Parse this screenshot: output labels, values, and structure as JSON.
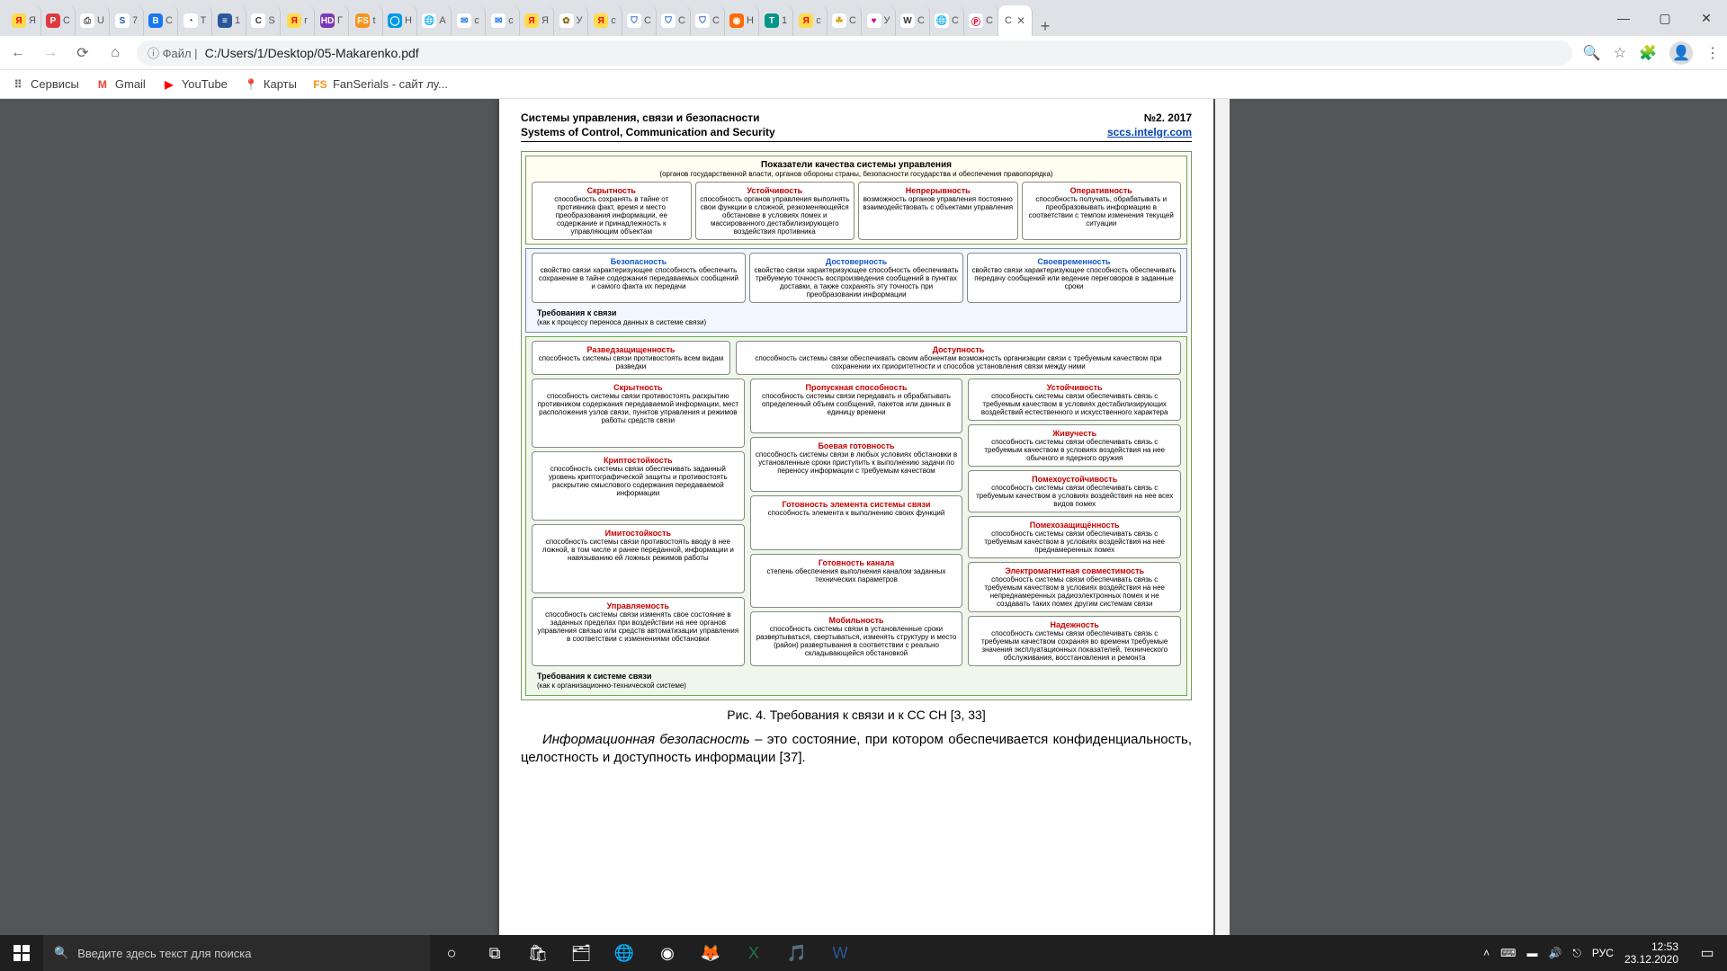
{
  "tabs": [
    {
      "fav": "Я",
      "favbg": "#ffdb4d",
      "favfg": "#f00",
      "txt": "Я"
    },
    {
      "fav": "P",
      "favbg": "#e03a3e",
      "favfg": "#fff",
      "txt": "С"
    },
    {
      "fav": "⎙",
      "favbg": "#fff",
      "favfg": "#555",
      "txt": "U"
    },
    {
      "fav": "S",
      "favbg": "#fff",
      "favfg": "#1e56a4",
      "txt": "7"
    },
    {
      "fav": "B",
      "favbg": "#1877f2",
      "favfg": "#fff",
      "txt": "C"
    },
    {
      "fav": "◔",
      "favbg": "#fff",
      "favfg": "#333",
      "txt": "Т"
    },
    {
      "fav": "≡",
      "favbg": "#2b579a",
      "favfg": "#fff",
      "txt": "1"
    },
    {
      "fav": "C",
      "favbg": "#fff",
      "favfg": "#333",
      "txt": "S"
    },
    {
      "fav": "Я",
      "favbg": "#ffdb4d",
      "favfg": "#f00",
      "txt": "r"
    },
    {
      "fav": "HD",
      "favbg": "#7b38b5",
      "favfg": "#fff",
      "txt": "Г"
    },
    {
      "fav": "FS",
      "favbg": "#f7931e",
      "favfg": "#fff",
      "txt": "t"
    },
    {
      "fav": "◯",
      "favbg": "#0099e5",
      "favfg": "#fff",
      "txt": "Н"
    },
    {
      "fav": "🌐",
      "favbg": "#fff",
      "favfg": "#666",
      "txt": "А"
    },
    {
      "fav": "✉",
      "favbg": "#fff",
      "favfg": "#1a73e8",
      "txt": "c"
    },
    {
      "fav": "✉",
      "favbg": "#fff",
      "favfg": "#1a73e8",
      "txt": "c"
    },
    {
      "fav": "Я",
      "favbg": "#ffdb4d",
      "favfg": "#f00",
      "txt": "Я"
    },
    {
      "fav": "✿",
      "favbg": "#fff",
      "favfg": "#8b6914",
      "txt": "У"
    },
    {
      "fav": "Я",
      "favbg": "#ffdb4d",
      "favfg": "#f00",
      "txt": "c"
    },
    {
      "fav": "⛉",
      "favbg": "#fff",
      "favfg": "#36c",
      "txt": "С"
    },
    {
      "fav": "⛉",
      "favbg": "#fff",
      "favfg": "#36c",
      "txt": "С"
    },
    {
      "fav": "⛉",
      "favbg": "#fff",
      "favfg": "#36c",
      "txt": "С"
    },
    {
      "fav": "◉",
      "favbg": "#ff6a00",
      "favfg": "#fff",
      "txt": "Н"
    },
    {
      "fav": "T",
      "favbg": "#009688",
      "favfg": "#fff",
      "txt": "1"
    },
    {
      "fav": "Я",
      "favbg": "#ffdb4d",
      "favfg": "#f00",
      "txt": "c"
    },
    {
      "fav": "☘",
      "favbg": "#fff",
      "favfg": "#d4a017",
      "txt": "С"
    },
    {
      "fav": "♥",
      "favbg": "#fff",
      "favfg": "#c09",
      "txt": "У"
    },
    {
      "fav": "W",
      "favbg": "#fff",
      "favfg": "#333",
      "txt": "С"
    },
    {
      "fav": "🌐",
      "favbg": "#fff",
      "favfg": "#666",
      "txt": "С"
    },
    {
      "fav": "Ⓟ",
      "favbg": "#fff",
      "favfg": "#e60023",
      "txt": "С"
    }
  ],
  "active_tab": {
    "fav": "",
    "txt": "C"
  },
  "address": {
    "info_label": "ⓘ Файл |",
    "path": "C:/Users/1/Desktop/05-Makarenko.pdf"
  },
  "bookmarks": [
    {
      "icon": "⠿",
      "label": "Сервисы",
      "color": "#5f6368"
    },
    {
      "icon": "M",
      "label": "Gmail",
      "color": "#ea4335"
    },
    {
      "icon": "▶",
      "label": "YouTube",
      "color": "#ff0000"
    },
    {
      "icon": "📍",
      "label": "Карты",
      "color": "#34a853"
    },
    {
      "icon": "FS",
      "label": "FanSerials - сайт лу...",
      "color": "#f7931e"
    }
  ],
  "pdf": {
    "journal_ru": "Системы управления, связи и безопасности",
    "journal_en": "Systems of Control, Communication and Security",
    "issue": "№2. 2017",
    "site": "sccs.intelgr.com",
    "top": {
      "title": "Показатели качества системы управления",
      "sub": "(органов государственной власти, органов обороны страны, безопасности государства и обеспечения правопорядка)",
      "cells": [
        {
          "t": "Скрытность",
          "d": "способность сохранять в тайне от противника факт, время и место преобразования информации, ее содержание и принадлежность к управляющим объектам"
        },
        {
          "t": "Устойчивость",
          "d": "способность органов управления выполнять свои функции в сложной, резкоменяющейся обстановке в условиях помех и массированного дестабилизирующего воздействия противника"
        },
        {
          "t": "Непрерывность",
          "d": "возможность органов управления постоянно взаимодействовать с объектами управления"
        },
        {
          "t": "Оперативность",
          "d": "способность получать, обрабатывать и преобразовывать информацию в соответствии с темпом изменения текущей ситуации"
        }
      ]
    },
    "mid": {
      "cells": [
        {
          "t": "Безопасность",
          "d": "свойство связи характеризующее способность обеспечить сохранение в тайне содержания передаваемых сообщений и самого факта их передачи"
        },
        {
          "t": "Достоверность",
          "d": "свойство связи характеризующее способность обеспечивать требуемую точность воспроизведения сообщений в пунктах доставки, а также сохранять эту точность при преобразовании информации"
        },
        {
          "t": "Своевременность",
          "d": "свойство связи характеризующее способность обеспечивать передачу сообщений или ведение переговоров в заданные сроки"
        }
      ],
      "req": "Требования к связи",
      "reqsub": "(как к процессу переноса данных в системе связи)"
    },
    "bot": {
      "row1": [
        {
          "t": "Разведзащищенность",
          "d": "способность системы связи противостоять всем видам разведки"
        },
        {
          "t": "Доступность",
          "d": "способность системы связи обеспечивать своим абонентам возможность организации связи с требуемым качеством при сохранении их приоритетности и способов установления связи между ними"
        }
      ],
      "colL": [
        {
          "t": "Скрытность",
          "d": "способность системы связи противостоять раскрытию противником содержания передаваемой информации, мест расположения узлов связи, пунктов управления и режимов работы средств связи"
        },
        {
          "t": "Криптостойкость",
          "d": "способность системы связи обеспечивать заданный уровень криптографической защиты и противостоять раскрытию смыслового содержания передаваемой информации"
        },
        {
          "t": "Имитостойкость",
          "d": "способность системы связи противостоять вводу в нее ложной, в том числе и ранее переданной, информации и навязыванию ей ложных режимов работы"
        },
        {
          "t": "Управляемость",
          "d": "способность системы связи изменять свое состояние в заданных пределах при воздействии на нее органов управления связью или средств автоматизации управления в соответствии с изменениями обстановки"
        }
      ],
      "colM": [
        {
          "t": "Пропускная способность",
          "d": "способность системы связи передавать и обрабатывать определенный объем сообщений, пакетов или данных в единицу времени"
        },
        {
          "t": "Боевая готовность",
          "d": "способность системы связи в любых условиях обстановки в установленные сроки приступить к выполнению задачи по переносу информации с требуемым качеством"
        },
        {
          "t": "Готовность элемента системы связи",
          "d": "способность элемента к выполнению своих функций"
        },
        {
          "t": "Готовность канала",
          "d": "степень обеспечения выполнения каналом заданных технических параметров"
        },
        {
          "t": "Мобильность",
          "d": "способность системы связи в установленные сроки развертываться, свертываться, изменять структуру и место (район) развертывания в соответствии с реально складывающейся обстановкой"
        }
      ],
      "colR": [
        {
          "t": "Устойчивость",
          "d": "способность системы связи обеспечивать связь с требуемым качеством в условиях дестабилизирующих воздействий естественного и искусственного характера"
        },
        {
          "t": "Живучесть",
          "d": "способность системы связи обеспечивать связь с требуемым качеством в условиях воздействия на нее обычного и ядерного оружия"
        },
        {
          "t": "Помехоустойчивость",
          "d": "способность системы связи обеспечивать связь с требуемым качеством в условиях воздействия на нее всех видов помех"
        },
        {
          "t": "Помехозащищённость",
          "d": "способность системы связи обеспечивать связь с требуемым качеством в условиях воздействия на нее преднамеренных помех"
        },
        {
          "t": "Электромагнитная совместимость",
          "d": "способность системы связи обеспечивать связь с требуемым качеством в условиях воздействия на нее непреднамеренных радиоэлектронных помех и не создавать таких помех другим системам связи"
        },
        {
          "t": "Надежность",
          "d": "способность системы связи обеспечивать связь с требуемым качеством сохраняя во времени требуемые значения эксплуатационных показателей, технического обслуживания, восстановления и ремонта"
        }
      ],
      "req": "Требования к системе связи",
      "reqsub": "(как к организационно-технической системе)"
    },
    "caption": "Рис. 4. Требования к связи и к СС СН [3, 33]",
    "para_pre": "Информационная безопасность",
    "para_rest": " – это состояние, при котором обеспечивается конфиденциальность, целостность и доступность информации [37]."
  },
  "taskbar": {
    "search": "Введите здесь текст для поиска",
    "lang": "РУС",
    "time": "12:53",
    "date": "23.12.2020"
  }
}
